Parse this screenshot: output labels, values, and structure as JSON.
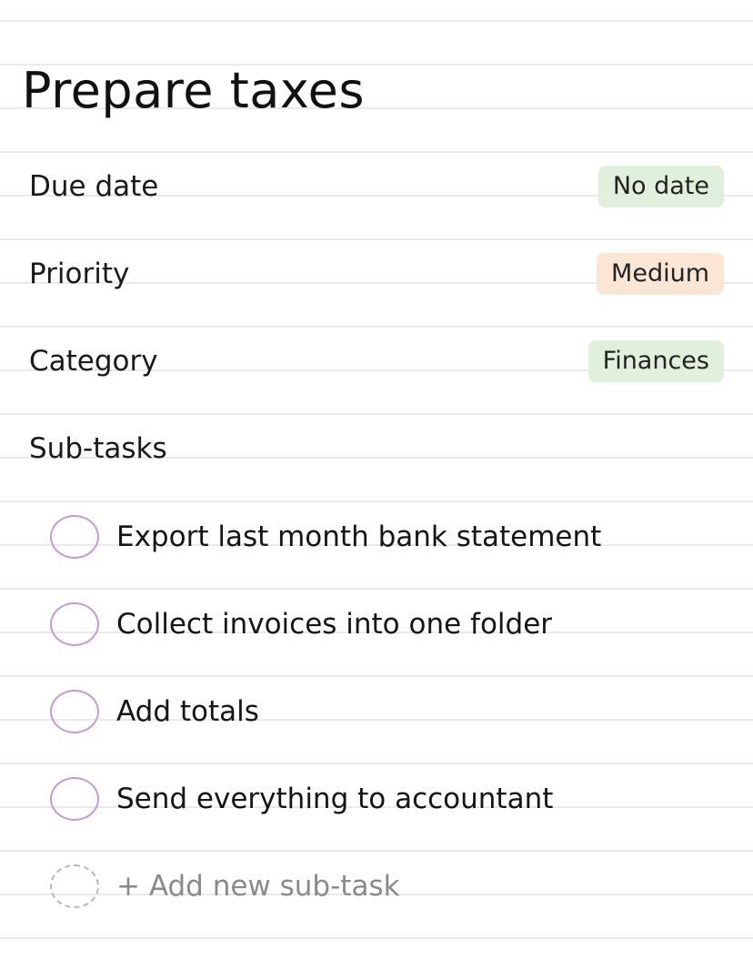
{
  "task": {
    "title": "Prepare taxes"
  },
  "fields": {
    "due_date": {
      "label": "Due date",
      "value": "No date",
      "color": "#e0f0dc"
    },
    "priority": {
      "label": "Priority",
      "value": "Medium",
      "color": "#fbe6d6"
    },
    "category": {
      "label": "Category",
      "value": "Finances",
      "color": "#e0f0dc"
    }
  },
  "subtasks": {
    "heading": "Sub-tasks",
    "items": [
      {
        "label": "Export last month bank statement",
        "done": false
      },
      {
        "label": "Collect invoices into one folder",
        "done": false
      },
      {
        "label": "Add totals",
        "done": false
      },
      {
        "label": "Send everything to accountant",
        "done": false
      }
    ],
    "add_label": "+ Add new sub-task"
  },
  "colors": {
    "checkbox_border": "#c79ad4",
    "ruled_line": "#e9e9e9"
  }
}
